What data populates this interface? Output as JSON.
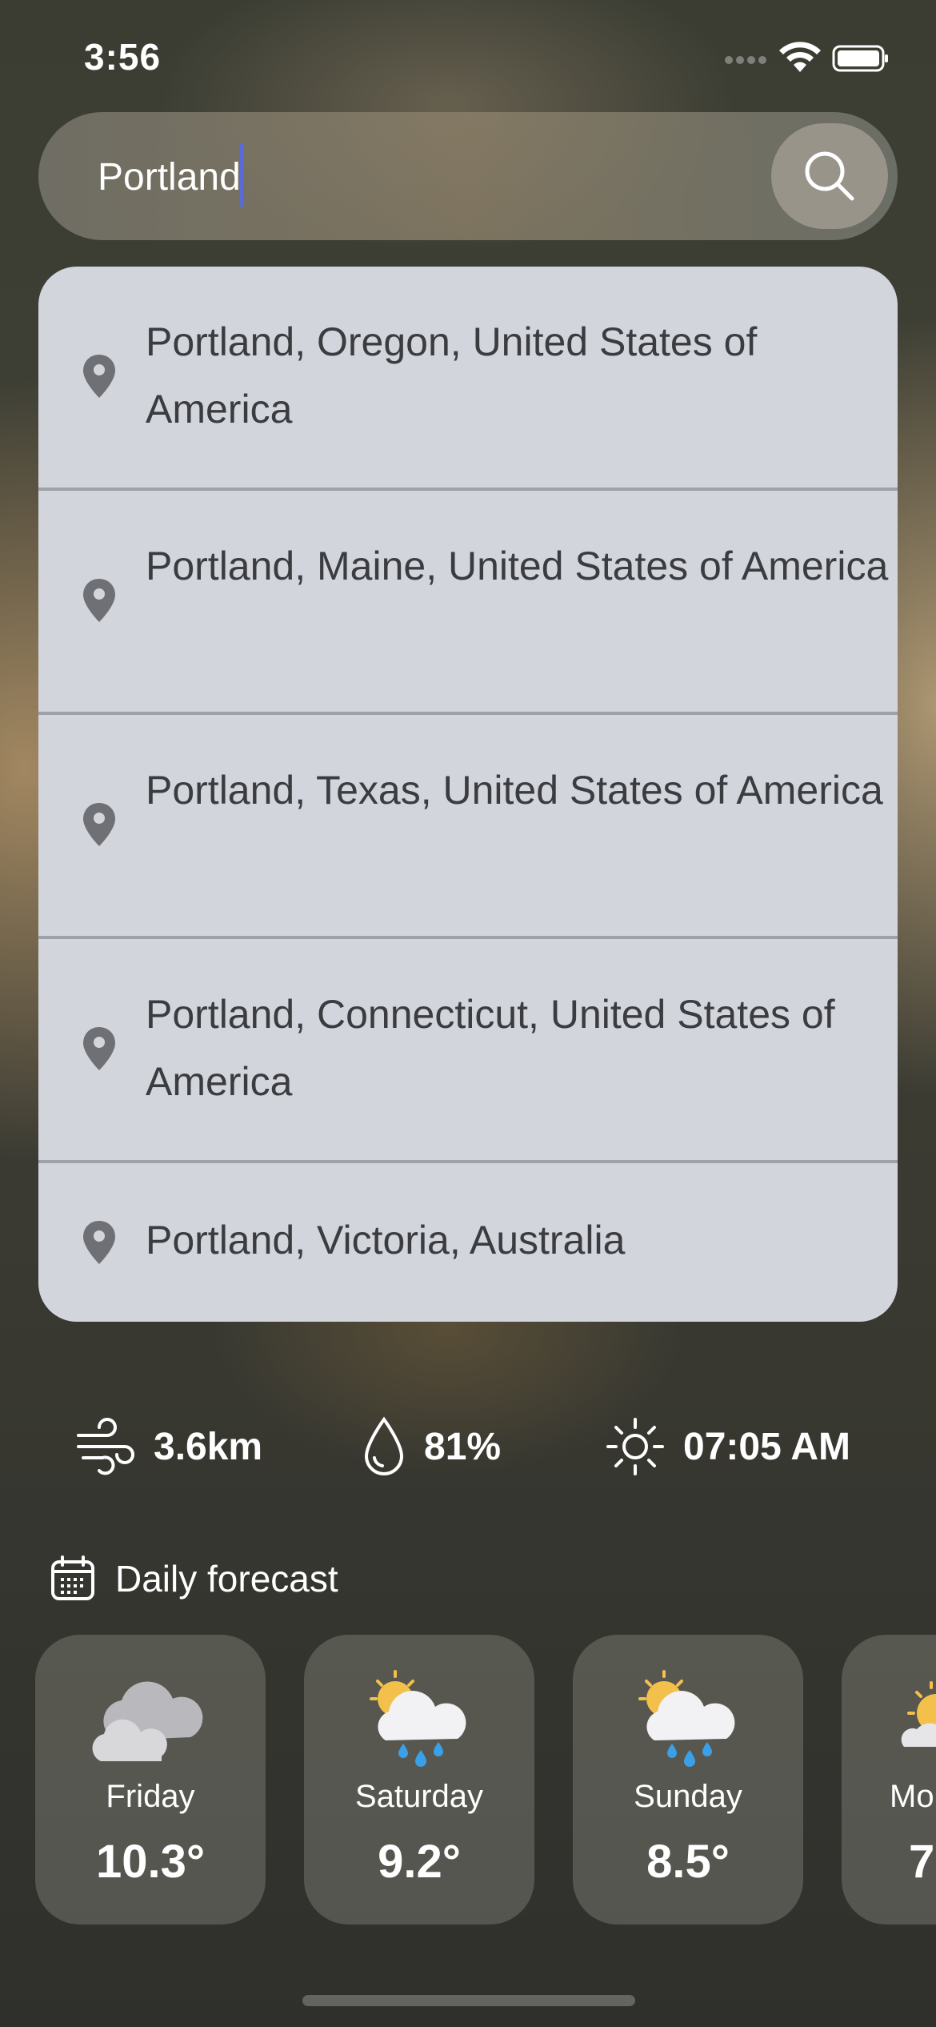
{
  "status_bar": {
    "time": "3:56"
  },
  "search": {
    "value": "Portland",
    "button_icon": "search-icon"
  },
  "suggestions": [
    {
      "label": "Portland, Oregon, United States of America"
    },
    {
      "label": "Portland, Maine, United States of America"
    },
    {
      "label": "Portland, Texas, United States of America"
    },
    {
      "label": "Portland, Connecticut, United States of America"
    },
    {
      "label": "Portland, Victoria, Australia"
    }
  ],
  "stats": {
    "wind": {
      "icon": "wind-icon",
      "value": "3.6km"
    },
    "humidity": {
      "icon": "droplet-icon",
      "value": "81%"
    },
    "sunrise": {
      "icon": "sun-icon",
      "value": "07:05 AM"
    }
  },
  "forecast": {
    "title": "Daily forecast",
    "days": [
      {
        "day": "Friday",
        "temp": "10.3°",
        "icon": "cloudy-icon"
      },
      {
        "day": "Saturday",
        "temp": "9.2°",
        "icon": "sun-cloud-rain-icon"
      },
      {
        "day": "Sunday",
        "temp": "8.5°",
        "icon": "sun-cloud-rain-icon"
      },
      {
        "day": "Mo",
        "temp": "7",
        "icon": "sun-cloud-icon"
      }
    ]
  },
  "colors": {
    "panel": "#d3d5dc",
    "divider": "#9ea1aa",
    "caret": "#5b6bd6"
  }
}
